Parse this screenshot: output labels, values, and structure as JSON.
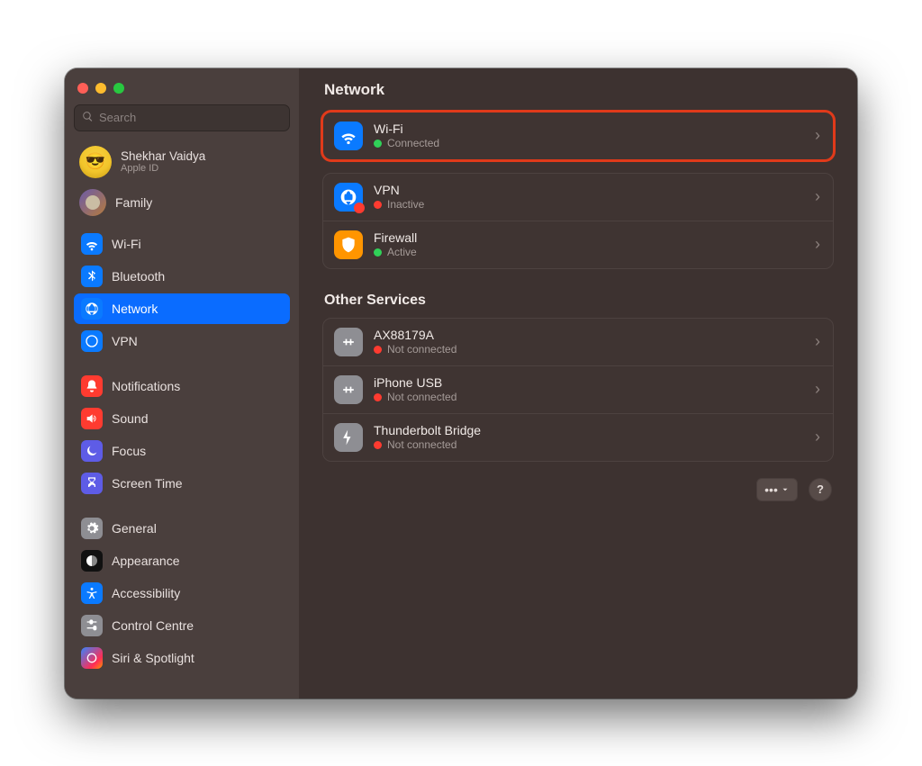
{
  "search": {
    "placeholder": "Search"
  },
  "account": {
    "name": "Shekhar Vaidya",
    "sub": "Apple ID"
  },
  "family": {
    "label": "Family"
  },
  "sidebar": {
    "items": [
      {
        "label": "Wi-Fi"
      },
      {
        "label": "Bluetooth"
      },
      {
        "label": "Network"
      },
      {
        "label": "VPN"
      },
      {
        "label": "Notifications"
      },
      {
        "label": "Sound"
      },
      {
        "label": "Focus"
      },
      {
        "label": "Screen Time"
      },
      {
        "label": "General"
      },
      {
        "label": "Appearance"
      },
      {
        "label": "Accessibility"
      },
      {
        "label": "Control Centre"
      },
      {
        "label": "Siri & Spotlight"
      }
    ]
  },
  "main": {
    "title": "Network",
    "primary": [
      {
        "name": "Wi-Fi",
        "status": "Connected",
        "dot": "green"
      },
      {
        "name": "VPN",
        "status": "Inactive",
        "dot": "red"
      },
      {
        "name": "Firewall",
        "status": "Active",
        "dot": "green"
      }
    ],
    "other_title": "Other Services",
    "other": [
      {
        "name": "AX88179A",
        "status": "Not connected",
        "dot": "red"
      },
      {
        "name": "iPhone USB",
        "status": "Not connected",
        "dot": "red"
      },
      {
        "name": "Thunderbolt Bridge",
        "status": "Not connected",
        "dot": "red"
      }
    ],
    "more_label": "•••",
    "help_label": "?"
  }
}
